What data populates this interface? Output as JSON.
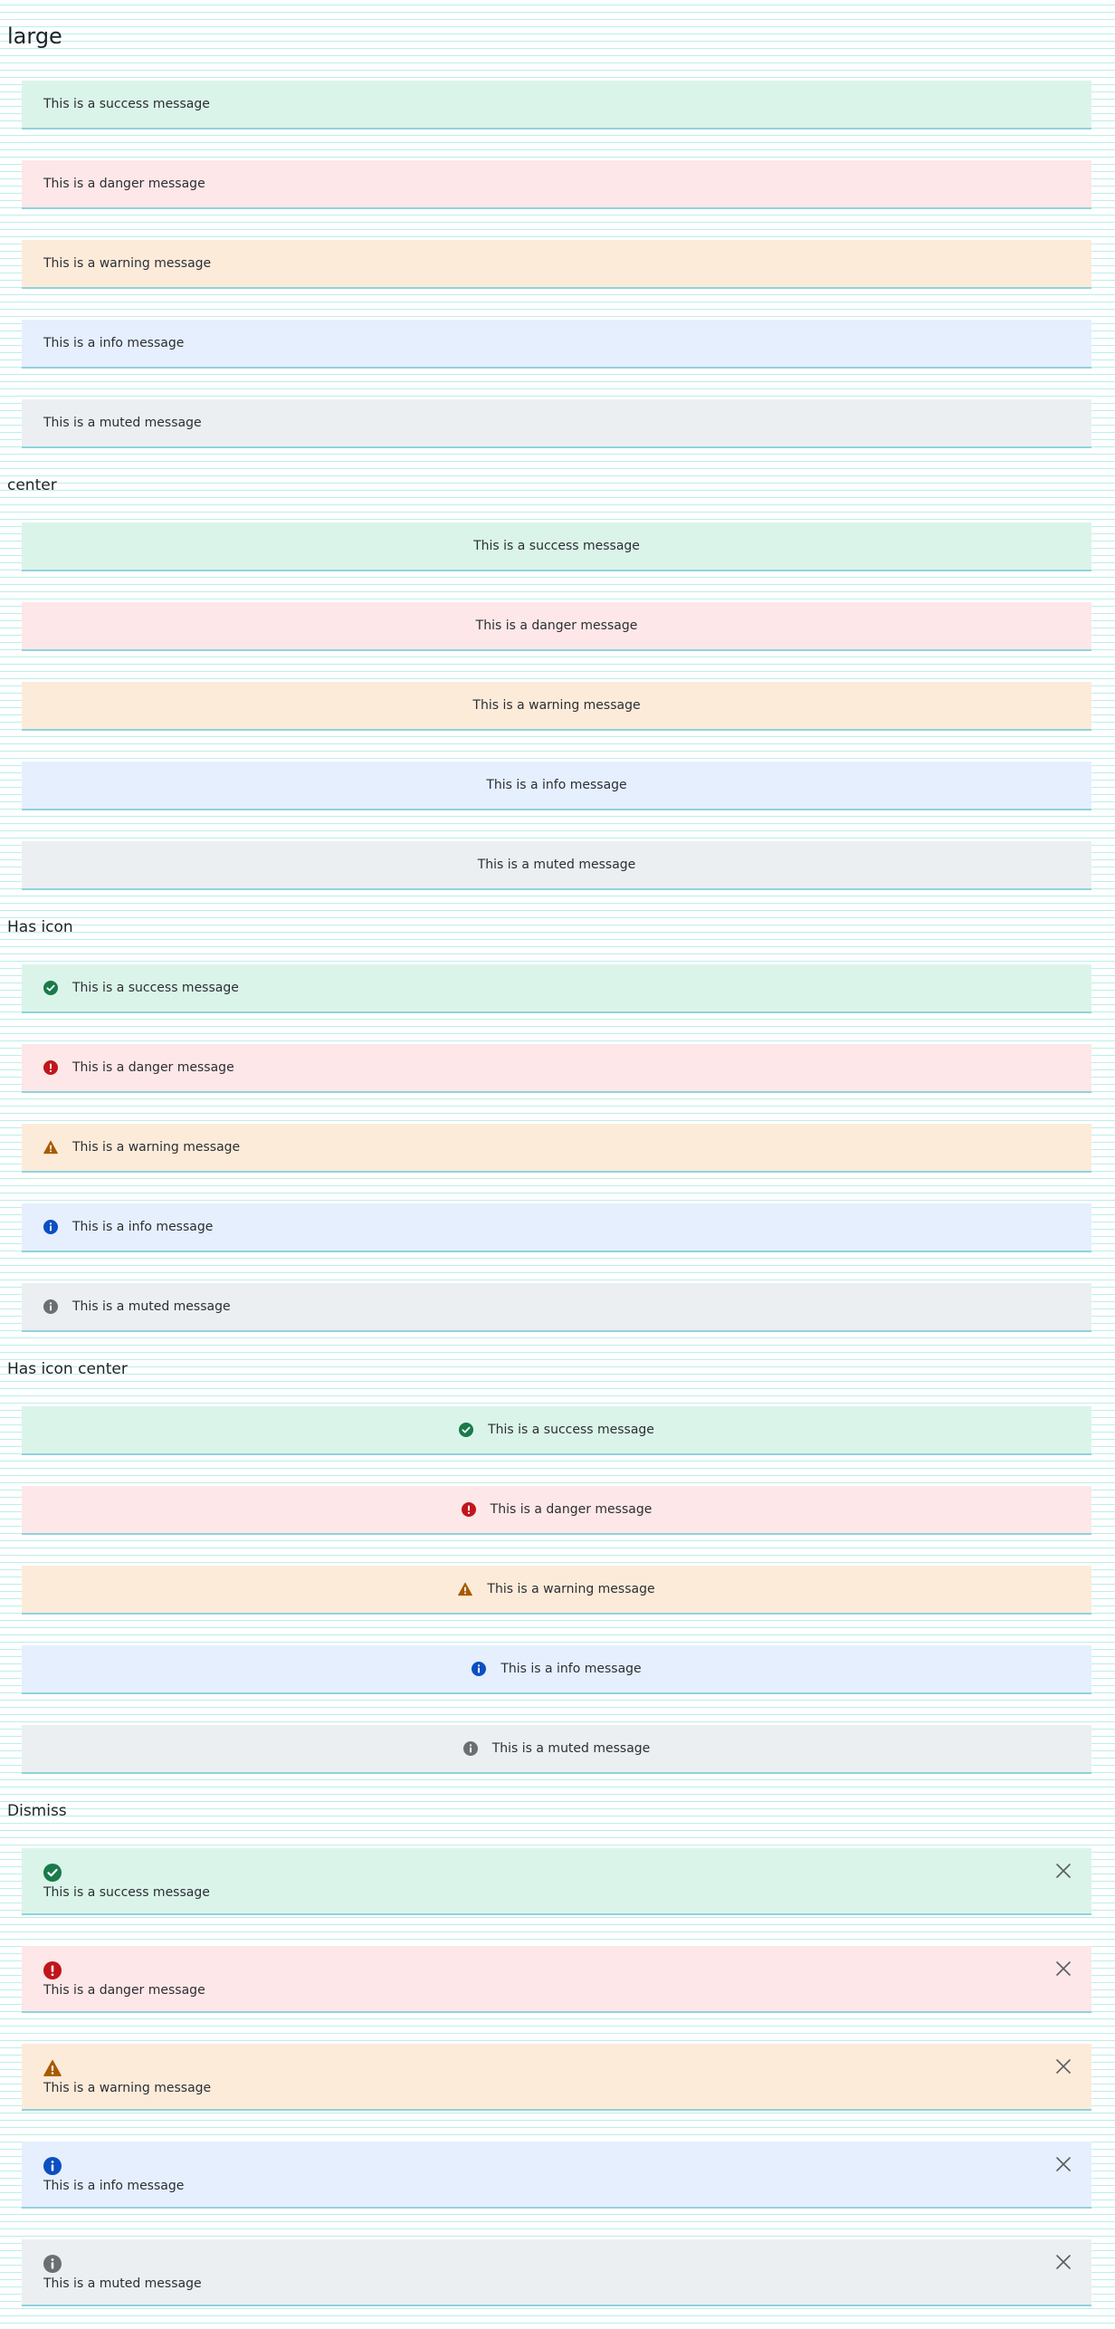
{
  "sections": {
    "large": {
      "title": "large"
    },
    "center": {
      "title": "center"
    },
    "has_icon": {
      "title": "Has icon"
    },
    "has_icon_center": {
      "title": "Has icon center"
    },
    "dismiss": {
      "title": "Dismiss"
    }
  },
  "messages": {
    "success": "This is a success message",
    "danger": "This is a danger message",
    "warning": "This is a warning message",
    "info": "This is a info message",
    "muted": "This is a muted message"
  },
  "colors": {
    "success_bg": "#dbf4e9",
    "danger_bg": "#fde7e8",
    "warning_bg": "#fdebda",
    "info_bg": "#e6effe",
    "muted_bg": "#eceff1",
    "success_icon": "#1a7a4a",
    "danger_icon": "#c0161b",
    "warning_icon": "#a85a00",
    "info_icon": "#0b4fc1",
    "muted_icon": "#6b6f73",
    "divider": "#8fd3de"
  },
  "icons": {
    "success": "check-circle-icon",
    "danger": "exclamation-circle-icon",
    "warning": "warning-triangle-icon",
    "info": "info-circle-icon",
    "muted": "info-circle-icon",
    "dismiss": "close-icon"
  }
}
